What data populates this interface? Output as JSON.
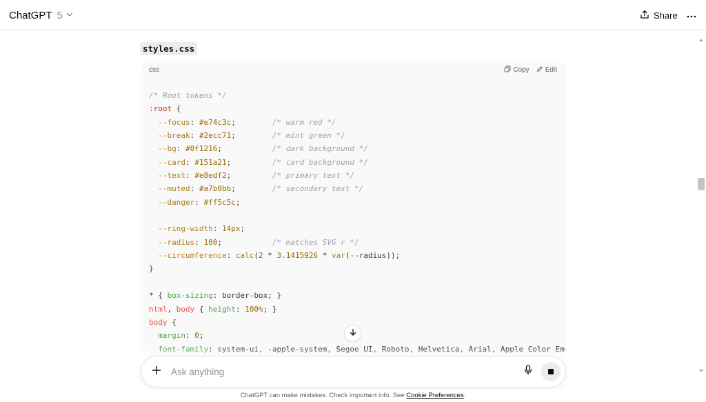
{
  "header": {
    "model_name": "ChatGPT",
    "model_version": "5",
    "share_label": "Share"
  },
  "file_chip": {
    "label": "styles.css"
  },
  "code_block": {
    "language": "css",
    "copy_label": "Copy",
    "edit_label": "Edit",
    "lines": [
      [
        [
          "comment",
          "/* Root tokens */"
        ]
      ],
      [
        [
          "selector",
          ":root"
        ],
        [
          "plain",
          " {"
        ]
      ],
      [
        [
          "plain",
          "  "
        ],
        [
          "var",
          "--focus"
        ],
        [
          "plain",
          ": "
        ],
        [
          "num",
          "#e74c3c"
        ],
        [
          "plain",
          ";        "
        ],
        [
          "comment",
          "/* warm red */"
        ]
      ],
      [
        [
          "plain",
          "  "
        ],
        [
          "var",
          "--break"
        ],
        [
          "plain",
          ": "
        ],
        [
          "num",
          "#2ecc71"
        ],
        [
          "plain",
          ";        "
        ],
        [
          "comment",
          "/* mint green */"
        ]
      ],
      [
        [
          "plain",
          "  "
        ],
        [
          "var",
          "--bg"
        ],
        [
          "plain",
          ": "
        ],
        [
          "num",
          "#0f1216"
        ],
        [
          "plain",
          ";           "
        ],
        [
          "comment",
          "/* dark background */"
        ]
      ],
      [
        [
          "plain",
          "  "
        ],
        [
          "var",
          "--card"
        ],
        [
          "plain",
          ": "
        ],
        [
          "num",
          "#151a21"
        ],
        [
          "plain",
          ";         "
        ],
        [
          "comment",
          "/* card background */"
        ]
      ],
      [
        [
          "plain",
          "  "
        ],
        [
          "var",
          "--text"
        ],
        [
          "plain",
          ": "
        ],
        [
          "num",
          "#e8edf2"
        ],
        [
          "plain",
          ";         "
        ],
        [
          "comment",
          "/* primary text */"
        ]
      ],
      [
        [
          "plain",
          "  "
        ],
        [
          "var",
          "--muted"
        ],
        [
          "plain",
          ": "
        ],
        [
          "num",
          "#a7b0bb"
        ],
        [
          "plain",
          ";        "
        ],
        [
          "comment",
          "/* secondary text */"
        ]
      ],
      [
        [
          "plain",
          "  "
        ],
        [
          "var",
          "--danger"
        ],
        [
          "plain",
          ": "
        ],
        [
          "num",
          "#ff5c5c"
        ],
        [
          "plain",
          ";"
        ]
      ],
      [],
      [
        [
          "plain",
          "  "
        ],
        [
          "var",
          "--ring-width"
        ],
        [
          "plain",
          ": "
        ],
        [
          "num",
          "14px"
        ],
        [
          "plain",
          ";"
        ]
      ],
      [
        [
          "plain",
          "  "
        ],
        [
          "var",
          "--radius"
        ],
        [
          "plain",
          ": "
        ],
        [
          "num",
          "100"
        ],
        [
          "plain",
          ";           "
        ],
        [
          "comment",
          "/* matches SVG r */"
        ]
      ],
      [
        [
          "plain",
          "  "
        ],
        [
          "var",
          "--circumference"
        ],
        [
          "plain",
          ": "
        ],
        [
          "fn",
          "calc"
        ],
        [
          "plain",
          "("
        ],
        [
          "num",
          "2"
        ],
        [
          "plain",
          " * "
        ],
        [
          "num",
          "3.1415926"
        ],
        [
          "plain",
          " * "
        ],
        [
          "fn",
          "var"
        ],
        [
          "plain",
          "(--radius));"
        ]
      ],
      [
        [
          "plain",
          "}"
        ]
      ],
      [],
      [
        [
          "plain",
          "* { "
        ],
        [
          "prop",
          "box-sizing"
        ],
        [
          "plain",
          ": border-box; }"
        ]
      ],
      [
        [
          "tag",
          "html"
        ],
        [
          "plain",
          ", "
        ],
        [
          "tag",
          "body"
        ],
        [
          "plain",
          " { "
        ],
        [
          "prop",
          "height"
        ],
        [
          "plain",
          ": "
        ],
        [
          "num",
          "100%"
        ],
        [
          "plain",
          "; }"
        ]
      ],
      [
        [
          "tag",
          "body"
        ],
        [
          "plain",
          " {"
        ]
      ],
      [
        [
          "plain",
          "  "
        ],
        [
          "prop",
          "margin"
        ],
        [
          "plain",
          ": "
        ],
        [
          "num",
          "0"
        ],
        [
          "plain",
          ";"
        ]
      ],
      [
        [
          "plain",
          "  "
        ],
        [
          "prop",
          "font-family"
        ],
        [
          "plain",
          ": system-ui, -apple-system, Segoe UI, Roboto, Helvetica, Arial, Apple Color Emoji, Se"
        ]
      ]
    ]
  },
  "composer": {
    "placeholder": "Ask anything"
  },
  "footer": {
    "note": "ChatGPT can make mistakes. Check important info. See ",
    "link": "Cookie Preferences",
    "end": "."
  },
  "colors": {
    "comment": "#a0a1a7",
    "selector": "#c2410c",
    "tag": "#e45649",
    "variable": "#b07a1a",
    "property": "#50a14f",
    "number": "#986801"
  },
  "icons": [
    "chevron-down-icon",
    "share-icon",
    "more-icon",
    "copy-icon",
    "edit-icon",
    "arrow-down-icon",
    "plus-icon",
    "mic-icon",
    "stop-icon"
  ]
}
